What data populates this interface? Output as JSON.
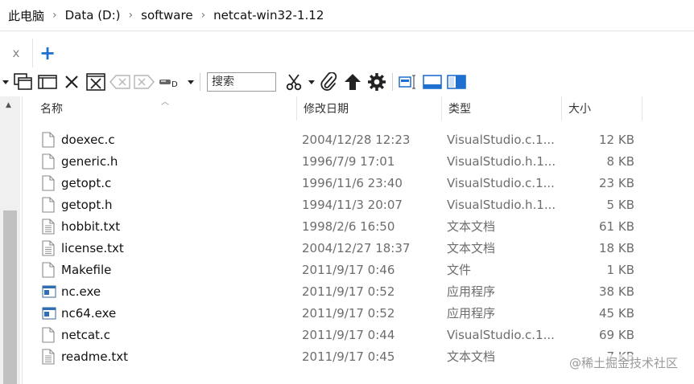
{
  "breadcrumb": [
    "此电脑",
    "Data (D:)",
    "software",
    "netcat-win32-1.12"
  ],
  "tabs": {
    "close_glyph": "x",
    "add_glyph": "+"
  },
  "search": {
    "placeholder": "搜索"
  },
  "columns": {
    "name": "名称",
    "date": "修改日期",
    "type": "类型",
    "size": "大小"
  },
  "files": [
    {
      "name": "doexec.c",
      "date": "2004/12/28 12:23",
      "type": "VisualStudio.c.1...",
      "size": "12 KB",
      "icon": "file-icon"
    },
    {
      "name": "generic.h",
      "date": "1996/7/9 17:01",
      "type": "VisualStudio.h.1...",
      "size": "8 KB",
      "icon": "file-icon"
    },
    {
      "name": "getopt.c",
      "date": "1996/11/6 23:40",
      "type": "VisualStudio.c.1...",
      "size": "23 KB",
      "icon": "file-icon"
    },
    {
      "name": "getopt.h",
      "date": "1994/11/3 20:07",
      "type": "VisualStudio.h.1...",
      "size": "5 KB",
      "icon": "file-icon"
    },
    {
      "name": "hobbit.txt",
      "date": "1998/2/6 16:50",
      "type": "文本文档",
      "size": "61 KB",
      "icon": "text-file-icon"
    },
    {
      "name": "license.txt",
      "date": "2004/12/27 18:37",
      "type": "文本文档",
      "size": "18 KB",
      "icon": "text-file-icon"
    },
    {
      "name": "Makefile",
      "date": "2011/9/17 0:46",
      "type": "文件",
      "size": "1 KB",
      "icon": "file-icon"
    },
    {
      "name": "nc.exe",
      "date": "2011/9/17 0:52",
      "type": "应用程序",
      "size": "38 KB",
      "icon": "exe-icon"
    },
    {
      "name": "nc64.exe",
      "date": "2011/9/17 0:52",
      "type": "应用程序",
      "size": "45 KB",
      "icon": "exe-icon"
    },
    {
      "name": "netcat.c",
      "date": "2011/9/17 0:44",
      "type": "VisualStudio.c.1...",
      "size": "69 KB",
      "icon": "file-icon"
    },
    {
      "name": "readme.txt",
      "date": "2011/9/17 0:45",
      "type": "文本文档",
      "size": "7 KB",
      "icon": "text-file-icon"
    }
  ],
  "watermark": "@稀土掘金技术社区",
  "colors": {
    "accent": "#1f6fd1",
    "secondary_text": "#6d6d6d",
    "scrollbar_thumb": "#c1c1c1"
  }
}
